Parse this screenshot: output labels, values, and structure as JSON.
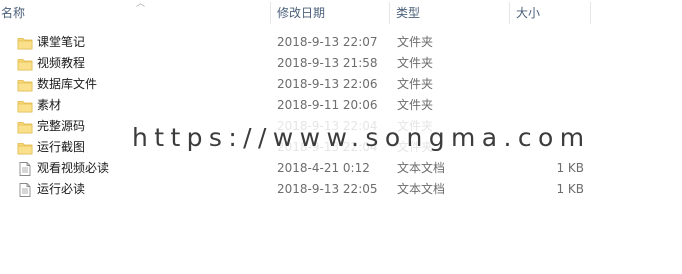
{
  "columns": {
    "name": "名称",
    "date": "修改日期",
    "type": "类型",
    "size": "大小"
  },
  "files": [
    {
      "name": "课堂笔记",
      "date": "2018-9-13 22:07",
      "type": "文件夹",
      "size": "",
      "icon": "folder-icon"
    },
    {
      "name": "视频教程",
      "date": "2018-9-13 21:58",
      "type": "文件夹",
      "size": "",
      "icon": "folder-icon"
    },
    {
      "name": "数据库文件",
      "date": "2018-9-13 22:06",
      "type": "文件夹",
      "size": "",
      "icon": "folder-icon"
    },
    {
      "name": "素材",
      "date": "2018-9-11 20:06",
      "type": "文件夹",
      "size": "",
      "icon": "folder-icon"
    },
    {
      "name": "完整源码",
      "date": "2018-9-13 22:04",
      "type": "文件夹",
      "size": "",
      "icon": "folder-icon"
    },
    {
      "name": "运行截图",
      "date": "2018-9-13 22:04",
      "type": "文件夹",
      "size": "",
      "icon": "folder-icon"
    },
    {
      "name": "观看视频必读",
      "date": "2018-4-21 0:12",
      "type": "文本文档",
      "size": "1 KB",
      "icon": "text-file-icon"
    },
    {
      "name": "运行必读",
      "date": "2018-9-13 22:05",
      "type": "文本文档",
      "size": "1 KB",
      "icon": "text-file-icon"
    }
  ],
  "watermark": "https://www.songma.com",
  "colors": {
    "header_text": "#4c607a",
    "folder": "#f8d775",
    "folder_dark": "#e0b84a"
  }
}
